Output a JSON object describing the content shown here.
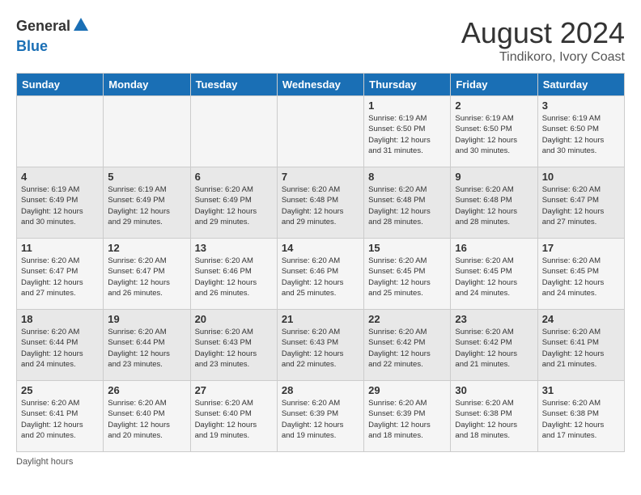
{
  "header": {
    "logo_line1": "General",
    "logo_line2": "Blue",
    "title": "August 2024",
    "subtitle": "Tindikoro, Ivory Coast"
  },
  "footer": {
    "label": "Daylight hours"
  },
  "weekdays": [
    "Sunday",
    "Monday",
    "Tuesday",
    "Wednesday",
    "Thursday",
    "Friday",
    "Saturday"
  ],
  "weeks": [
    [
      {
        "day": "",
        "info": ""
      },
      {
        "day": "",
        "info": ""
      },
      {
        "day": "",
        "info": ""
      },
      {
        "day": "",
        "info": ""
      },
      {
        "day": "1",
        "info": "Sunrise: 6:19 AM\nSunset: 6:50 PM\nDaylight: 12 hours\nand 31 minutes."
      },
      {
        "day": "2",
        "info": "Sunrise: 6:19 AM\nSunset: 6:50 PM\nDaylight: 12 hours\nand 30 minutes."
      },
      {
        "day": "3",
        "info": "Sunrise: 6:19 AM\nSunset: 6:50 PM\nDaylight: 12 hours\nand 30 minutes."
      }
    ],
    [
      {
        "day": "4",
        "info": "Sunrise: 6:19 AM\nSunset: 6:49 PM\nDaylight: 12 hours\nand 30 minutes."
      },
      {
        "day": "5",
        "info": "Sunrise: 6:19 AM\nSunset: 6:49 PM\nDaylight: 12 hours\nand 29 minutes."
      },
      {
        "day": "6",
        "info": "Sunrise: 6:20 AM\nSunset: 6:49 PM\nDaylight: 12 hours\nand 29 minutes."
      },
      {
        "day": "7",
        "info": "Sunrise: 6:20 AM\nSunset: 6:48 PM\nDaylight: 12 hours\nand 29 minutes."
      },
      {
        "day": "8",
        "info": "Sunrise: 6:20 AM\nSunset: 6:48 PM\nDaylight: 12 hours\nand 28 minutes."
      },
      {
        "day": "9",
        "info": "Sunrise: 6:20 AM\nSunset: 6:48 PM\nDaylight: 12 hours\nand 28 minutes."
      },
      {
        "day": "10",
        "info": "Sunrise: 6:20 AM\nSunset: 6:47 PM\nDaylight: 12 hours\nand 27 minutes."
      }
    ],
    [
      {
        "day": "11",
        "info": "Sunrise: 6:20 AM\nSunset: 6:47 PM\nDaylight: 12 hours\nand 27 minutes."
      },
      {
        "day": "12",
        "info": "Sunrise: 6:20 AM\nSunset: 6:47 PM\nDaylight: 12 hours\nand 26 minutes."
      },
      {
        "day": "13",
        "info": "Sunrise: 6:20 AM\nSunset: 6:46 PM\nDaylight: 12 hours\nand 26 minutes."
      },
      {
        "day": "14",
        "info": "Sunrise: 6:20 AM\nSunset: 6:46 PM\nDaylight: 12 hours\nand 25 minutes."
      },
      {
        "day": "15",
        "info": "Sunrise: 6:20 AM\nSunset: 6:45 PM\nDaylight: 12 hours\nand 25 minutes."
      },
      {
        "day": "16",
        "info": "Sunrise: 6:20 AM\nSunset: 6:45 PM\nDaylight: 12 hours\nand 24 minutes."
      },
      {
        "day": "17",
        "info": "Sunrise: 6:20 AM\nSunset: 6:45 PM\nDaylight: 12 hours\nand 24 minutes."
      }
    ],
    [
      {
        "day": "18",
        "info": "Sunrise: 6:20 AM\nSunset: 6:44 PM\nDaylight: 12 hours\nand 24 minutes."
      },
      {
        "day": "19",
        "info": "Sunrise: 6:20 AM\nSunset: 6:44 PM\nDaylight: 12 hours\nand 23 minutes."
      },
      {
        "day": "20",
        "info": "Sunrise: 6:20 AM\nSunset: 6:43 PM\nDaylight: 12 hours\nand 23 minutes."
      },
      {
        "day": "21",
        "info": "Sunrise: 6:20 AM\nSunset: 6:43 PM\nDaylight: 12 hours\nand 22 minutes."
      },
      {
        "day": "22",
        "info": "Sunrise: 6:20 AM\nSunset: 6:42 PM\nDaylight: 12 hours\nand 22 minutes."
      },
      {
        "day": "23",
        "info": "Sunrise: 6:20 AM\nSunset: 6:42 PM\nDaylight: 12 hours\nand 21 minutes."
      },
      {
        "day": "24",
        "info": "Sunrise: 6:20 AM\nSunset: 6:41 PM\nDaylight: 12 hours\nand 21 minutes."
      }
    ],
    [
      {
        "day": "25",
        "info": "Sunrise: 6:20 AM\nSunset: 6:41 PM\nDaylight: 12 hours\nand 20 minutes."
      },
      {
        "day": "26",
        "info": "Sunrise: 6:20 AM\nSunset: 6:40 PM\nDaylight: 12 hours\nand 20 minutes."
      },
      {
        "day": "27",
        "info": "Sunrise: 6:20 AM\nSunset: 6:40 PM\nDaylight: 12 hours\nand 19 minutes."
      },
      {
        "day": "28",
        "info": "Sunrise: 6:20 AM\nSunset: 6:39 PM\nDaylight: 12 hours\nand 19 minutes."
      },
      {
        "day": "29",
        "info": "Sunrise: 6:20 AM\nSunset: 6:39 PM\nDaylight: 12 hours\nand 18 minutes."
      },
      {
        "day": "30",
        "info": "Sunrise: 6:20 AM\nSunset: 6:38 PM\nDaylight: 12 hours\nand 18 minutes."
      },
      {
        "day": "31",
        "info": "Sunrise: 6:20 AM\nSunset: 6:38 PM\nDaylight: 12 hours\nand 17 minutes."
      }
    ]
  ]
}
